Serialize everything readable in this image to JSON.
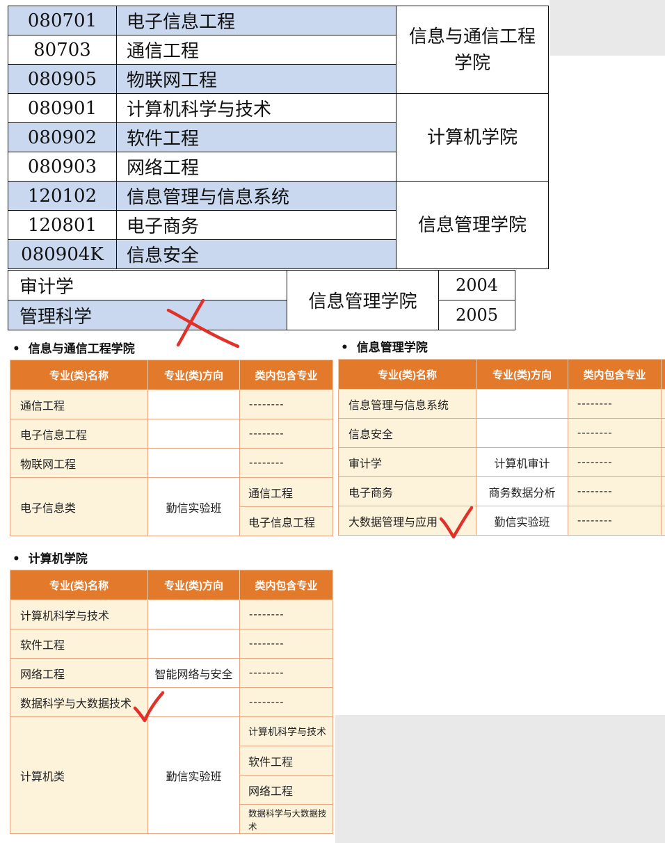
{
  "top_table": {
    "groups": [
      {
        "dept": "信息与通信工程学院",
        "rows": [
          {
            "code": "080701",
            "name": "电子信息工程"
          },
          {
            "code": "80703",
            "name": "通信工程"
          },
          {
            "code": "080905",
            "name": "物联网工程"
          }
        ]
      },
      {
        "dept": "计算机学院",
        "rows": [
          {
            "code": "080901",
            "name": "计算机科学与技术"
          },
          {
            "code": "080902",
            "name": "软件工程"
          },
          {
            "code": "080903",
            "name": "网络工程"
          }
        ]
      },
      {
        "dept": "信息管理学院",
        "rows": [
          {
            "code": "120102",
            "name": "信息管理与信息系统"
          },
          {
            "code": "120801",
            "name": "电子商务"
          },
          {
            "code": "080904K",
            "name": "信息安全"
          }
        ]
      }
    ]
  },
  "second_table": {
    "dept": "信息管理学院",
    "rows": [
      {
        "name": "审计学",
        "year": "2004"
      },
      {
        "name": "管理科学",
        "year": "2005"
      }
    ]
  },
  "sections": {
    "info_comm": {
      "title": "信息与通信工程学院",
      "headers": [
        "专业(类)名称",
        "专业(类)方向",
        "类内包含专业"
      ],
      "rows": [
        {
          "name": "通信工程",
          "direction": "",
          "contains": "--------"
        },
        {
          "name": "电子信息工程",
          "direction": "",
          "contains": "--------"
        },
        {
          "name": "物联网工程",
          "direction": "",
          "contains": "--------"
        }
      ],
      "group_row": {
        "name": "电子信息类",
        "direction": "勤信实验班",
        "contains": [
          "通信工程",
          "电子信息工程"
        ]
      }
    },
    "info_mgmt": {
      "title": "信息管理学院",
      "headers": [
        "专业(类)名称",
        "专业(类)方向",
        "类内包含专业"
      ],
      "rows": [
        {
          "name": "信息管理与信息系统",
          "direction": "",
          "contains": "--------"
        },
        {
          "name": "信息安全",
          "direction": "",
          "contains": "--------"
        },
        {
          "name": "审计学",
          "direction": "计算机审计",
          "contains": "--------"
        },
        {
          "name": "电子商务",
          "direction": "商务数据分析",
          "contains": "--------"
        },
        {
          "name": "大数据管理与应用",
          "direction": "勤信实验班",
          "contains": "--------"
        }
      ]
    },
    "computer": {
      "title": "计算机学院",
      "headers": [
        "专业(类)名称",
        "专业(类)方向",
        "类内包含专业"
      ],
      "rows": [
        {
          "name": "计算机科学与技术",
          "direction": "",
          "contains": "--------"
        },
        {
          "name": "软件工程",
          "direction": "",
          "contains": "--------"
        },
        {
          "name": "网络工程",
          "direction": "智能网络与安全",
          "contains": "--------"
        },
        {
          "name": "数据科学与大数据技术",
          "direction": "",
          "contains": "--------"
        }
      ],
      "group_row": {
        "name": "计算机类",
        "direction": "勤信实验班",
        "contains": [
          "计算机科学与技术",
          "软件工程",
          "网络工程",
          "数据科学与大数据技术"
        ]
      }
    }
  },
  "colors": {
    "header_orange": "#e3792b",
    "cell_cream": "#fdf3da",
    "row_blue": "#c9d8ef",
    "ink_red": "#e0322a"
  },
  "annotations": [
    "cross-mark",
    "check-mark",
    "check-mark"
  ]
}
